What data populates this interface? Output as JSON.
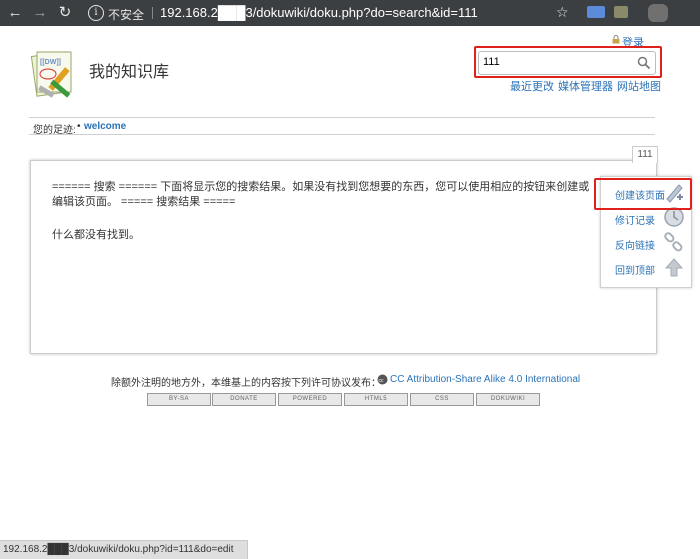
{
  "browser": {
    "security_label": "不安全",
    "url": "192.168.2███3/dokuwiki/doku.php?do=search&id=111"
  },
  "header": {
    "login_label": "登录",
    "site_title": "我的知识库",
    "search_value": "111",
    "links": [
      "最近更改",
      "媒体管理器",
      "网站地图"
    ]
  },
  "breadcrumb": {
    "label": "您的足迹:",
    "bullet": "•",
    "item": "welcome"
  },
  "page": {
    "id": "111",
    "content": "====== 搜索 ====== 下面将显示您的搜索结果。如果没有找到您想要的东西，您可以使用相应的按钮来创建或编辑该页面。 ===== 搜索结果 =====",
    "no_result": "什么都没有找到。"
  },
  "page_tools": [
    {
      "label": "创建该页面",
      "icon": "create-page-icon"
    },
    {
      "label": "修订记录",
      "icon": "history-icon"
    },
    {
      "label": "反向链接",
      "icon": "backlink-icon"
    },
    {
      "label": "回到顶部",
      "icon": "back-to-top-icon"
    }
  ],
  "footer": {
    "license_text": "除额外注明的地方外，本维基上的内容按下列许可协议发布：",
    "license_link": "CC Attribution-Share Alike 4.0 International",
    "badges": [
      "BY-SA",
      "DONATE",
      "POWERED",
      "HTML5",
      "CSS",
      "DOKUWIKI"
    ]
  },
  "statusbar": {
    "url": "192.168.2███3/dokuwiki/doku.php?id=111&do=edit"
  },
  "colors": {
    "link": "#2b73b7",
    "highlight_frame": "#e0201a",
    "chrome": "#3c3f41"
  }
}
